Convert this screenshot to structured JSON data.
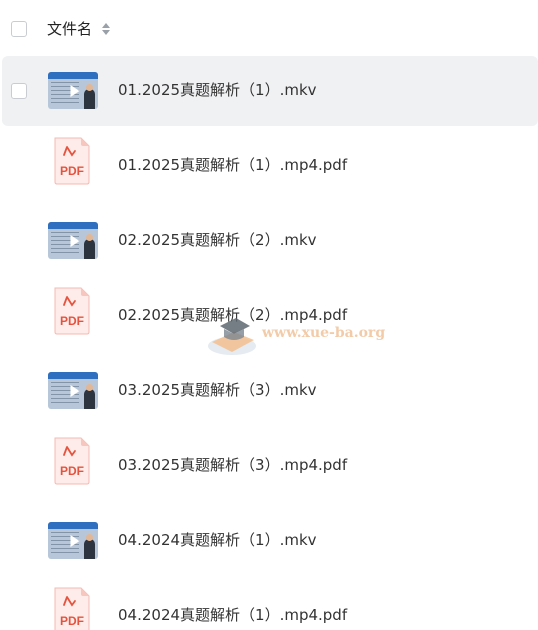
{
  "header": {
    "column_label": "文件名",
    "sort_icon": "sort-icon"
  },
  "files": [
    {
      "name": "01.2025真题解析（1）.mkv",
      "type": "video",
      "icon": "video-thumbnail",
      "selected": true
    },
    {
      "name": "01.2025真题解析（1）.mp4.pdf",
      "type": "pdf",
      "icon": "pdf-icon",
      "selected": false
    },
    {
      "name": "02.2025真题解析（2）.mkv",
      "type": "video",
      "icon": "video-thumbnail",
      "selected": false
    },
    {
      "name": "02.2025真题解析（2）.mp4.pdf",
      "type": "pdf",
      "icon": "pdf-icon",
      "selected": false
    },
    {
      "name": "03.2025真题解析（3）.mkv",
      "type": "video",
      "icon": "video-thumbnail",
      "selected": false
    },
    {
      "name": "03.2025真题解析（3）.mp4.pdf",
      "type": "pdf",
      "icon": "pdf-icon",
      "selected": false
    },
    {
      "name": "04.2024真题解析（1）.mkv",
      "type": "video",
      "icon": "video-thumbnail",
      "selected": false
    },
    {
      "name": "04.2024真题解析（1）.mp4.pdf",
      "type": "pdf",
      "icon": "pdf-icon",
      "selected": false
    }
  ],
  "pdf_badge_label": "PDF",
  "watermark": {
    "text": "www.xue-ba.org",
    "icon": "graduation-cap-icon"
  },
  "colors": {
    "selected_row": "#f0f1f3",
    "pdf_red": "#e5533f",
    "video_header": "#2f6fc0",
    "watermark": "#f0c39a"
  }
}
